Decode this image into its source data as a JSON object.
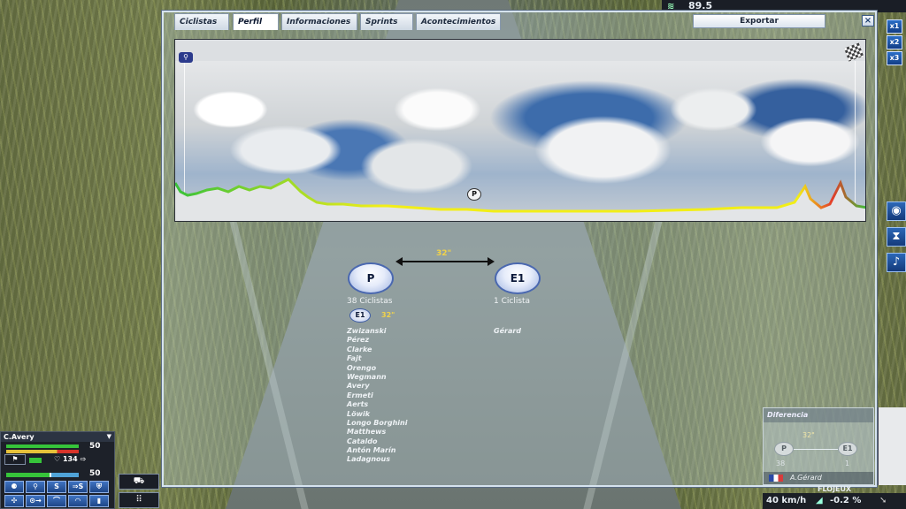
{
  "hud": {
    "top_value": "89.5",
    "speed_buttons": [
      "x1",
      "x2",
      "x3"
    ],
    "status_speed": "40 km/h",
    "status_slope": "-0.2 %",
    "status_rider_top": "FLOJEUX"
  },
  "window": {
    "tabs": [
      "Ciclistas",
      "Perfil",
      "Informaciones",
      "Sprints",
      "Acontecimientos"
    ],
    "active_tab": "Perfil",
    "export_label": "Exportar",
    "close_symbol": "×"
  },
  "profile": {
    "peloton_marker": "P"
  },
  "groups": {
    "gap_label": "32\"",
    "group1": {
      "label": "P",
      "count": "38 Ciclistas"
    },
    "group2": {
      "label": "E1",
      "count": "1 Ciclista"
    },
    "sub_badge": "E1",
    "sub_gap": "32\"",
    "group1_riders": [
      "Zwizanski",
      "Pérez",
      "Clarke",
      "Fajt",
      "Orengo",
      "Wegmann",
      "Avery",
      "Ermeti",
      "Aerts",
      "Löwik",
      "Longo Borghini",
      "Matthews",
      "Cataldo",
      "Antón Marín",
      "Ladagnous"
    ],
    "group2_riders": [
      "Gérard"
    ]
  },
  "diferencia": {
    "title": "Diferencia",
    "gap": "32\"",
    "left_label": "P",
    "right_label": "E1",
    "left_count": "38",
    "right_count": "1",
    "rider": "A.Gérard"
  },
  "rider_panel": {
    "name": "C.Avery",
    "effort_value": "50",
    "heart_value": "134",
    "bottom_value": "50"
  }
}
